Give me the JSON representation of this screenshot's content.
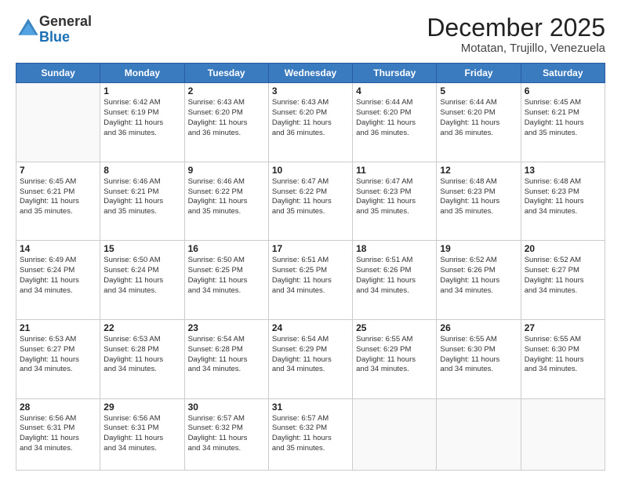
{
  "header": {
    "logo_general": "General",
    "logo_blue": "Blue",
    "month": "December 2025",
    "location": "Motatan, Trujillo, Venezuela"
  },
  "weekdays": [
    "Sunday",
    "Monday",
    "Tuesday",
    "Wednesday",
    "Thursday",
    "Friday",
    "Saturday"
  ],
  "weeks": [
    [
      {
        "day": "",
        "info": ""
      },
      {
        "day": "1",
        "info": "Sunrise: 6:42 AM\nSunset: 6:19 PM\nDaylight: 11 hours\nand 36 minutes."
      },
      {
        "day": "2",
        "info": "Sunrise: 6:43 AM\nSunset: 6:20 PM\nDaylight: 11 hours\nand 36 minutes."
      },
      {
        "day": "3",
        "info": "Sunrise: 6:43 AM\nSunset: 6:20 PM\nDaylight: 11 hours\nand 36 minutes."
      },
      {
        "day": "4",
        "info": "Sunrise: 6:44 AM\nSunset: 6:20 PM\nDaylight: 11 hours\nand 36 minutes."
      },
      {
        "day": "5",
        "info": "Sunrise: 6:44 AM\nSunset: 6:20 PM\nDaylight: 11 hours\nand 36 minutes."
      },
      {
        "day": "6",
        "info": "Sunrise: 6:45 AM\nSunset: 6:21 PM\nDaylight: 11 hours\nand 35 minutes."
      }
    ],
    [
      {
        "day": "7",
        "info": "Sunrise: 6:45 AM\nSunset: 6:21 PM\nDaylight: 11 hours\nand 35 minutes."
      },
      {
        "day": "8",
        "info": "Sunrise: 6:46 AM\nSunset: 6:21 PM\nDaylight: 11 hours\nand 35 minutes."
      },
      {
        "day": "9",
        "info": "Sunrise: 6:46 AM\nSunset: 6:22 PM\nDaylight: 11 hours\nand 35 minutes."
      },
      {
        "day": "10",
        "info": "Sunrise: 6:47 AM\nSunset: 6:22 PM\nDaylight: 11 hours\nand 35 minutes."
      },
      {
        "day": "11",
        "info": "Sunrise: 6:47 AM\nSunset: 6:23 PM\nDaylight: 11 hours\nand 35 minutes."
      },
      {
        "day": "12",
        "info": "Sunrise: 6:48 AM\nSunset: 6:23 PM\nDaylight: 11 hours\nand 35 minutes."
      },
      {
        "day": "13",
        "info": "Sunrise: 6:48 AM\nSunset: 6:23 PM\nDaylight: 11 hours\nand 34 minutes."
      }
    ],
    [
      {
        "day": "14",
        "info": "Sunrise: 6:49 AM\nSunset: 6:24 PM\nDaylight: 11 hours\nand 34 minutes."
      },
      {
        "day": "15",
        "info": "Sunrise: 6:50 AM\nSunset: 6:24 PM\nDaylight: 11 hours\nand 34 minutes."
      },
      {
        "day": "16",
        "info": "Sunrise: 6:50 AM\nSunset: 6:25 PM\nDaylight: 11 hours\nand 34 minutes."
      },
      {
        "day": "17",
        "info": "Sunrise: 6:51 AM\nSunset: 6:25 PM\nDaylight: 11 hours\nand 34 minutes."
      },
      {
        "day": "18",
        "info": "Sunrise: 6:51 AM\nSunset: 6:26 PM\nDaylight: 11 hours\nand 34 minutes."
      },
      {
        "day": "19",
        "info": "Sunrise: 6:52 AM\nSunset: 6:26 PM\nDaylight: 11 hours\nand 34 minutes."
      },
      {
        "day": "20",
        "info": "Sunrise: 6:52 AM\nSunset: 6:27 PM\nDaylight: 11 hours\nand 34 minutes."
      }
    ],
    [
      {
        "day": "21",
        "info": "Sunrise: 6:53 AM\nSunset: 6:27 PM\nDaylight: 11 hours\nand 34 minutes."
      },
      {
        "day": "22",
        "info": "Sunrise: 6:53 AM\nSunset: 6:28 PM\nDaylight: 11 hours\nand 34 minutes."
      },
      {
        "day": "23",
        "info": "Sunrise: 6:54 AM\nSunset: 6:28 PM\nDaylight: 11 hours\nand 34 minutes."
      },
      {
        "day": "24",
        "info": "Sunrise: 6:54 AM\nSunset: 6:29 PM\nDaylight: 11 hours\nand 34 minutes."
      },
      {
        "day": "25",
        "info": "Sunrise: 6:55 AM\nSunset: 6:29 PM\nDaylight: 11 hours\nand 34 minutes."
      },
      {
        "day": "26",
        "info": "Sunrise: 6:55 AM\nSunset: 6:30 PM\nDaylight: 11 hours\nand 34 minutes."
      },
      {
        "day": "27",
        "info": "Sunrise: 6:55 AM\nSunset: 6:30 PM\nDaylight: 11 hours\nand 34 minutes."
      }
    ],
    [
      {
        "day": "28",
        "info": "Sunrise: 6:56 AM\nSunset: 6:31 PM\nDaylight: 11 hours\nand 34 minutes."
      },
      {
        "day": "29",
        "info": "Sunrise: 6:56 AM\nSunset: 6:31 PM\nDaylight: 11 hours\nand 34 minutes."
      },
      {
        "day": "30",
        "info": "Sunrise: 6:57 AM\nSunset: 6:32 PM\nDaylight: 11 hours\nand 34 minutes."
      },
      {
        "day": "31",
        "info": "Sunrise: 6:57 AM\nSunset: 6:32 PM\nDaylight: 11 hours\nand 35 minutes."
      },
      {
        "day": "",
        "info": ""
      },
      {
        "day": "",
        "info": ""
      },
      {
        "day": "",
        "info": ""
      }
    ]
  ]
}
